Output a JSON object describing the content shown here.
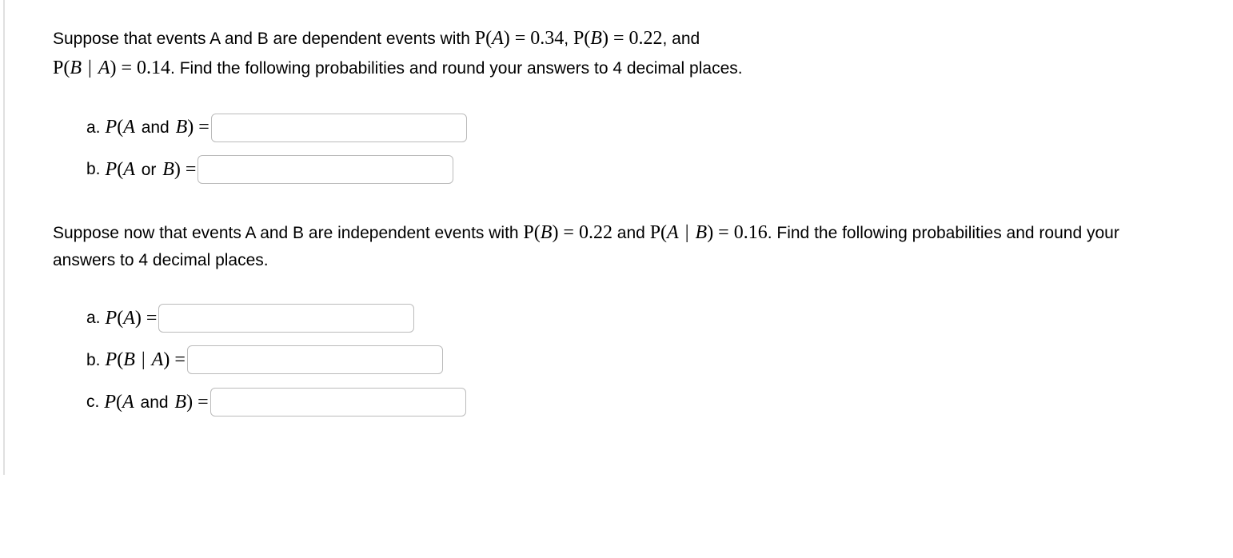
{
  "part1": {
    "intro_prefix": "Suppose that events A and B are dependent events with ",
    "pa_expr": "P(A) = 0.34",
    "sep1": ", ",
    "pb_expr": "P(B) = 0.22",
    "sep2": ", and ",
    "pba_expr": "P(B | A) = 0.14",
    "intro_suffix": ". Find the following probabilities and round your answers to 4 decimal places.",
    "items": [
      {
        "letter": "a.",
        "expr_left": "P(A",
        "word": " and ",
        "expr_right": "B) ="
      },
      {
        "letter": "b.",
        "expr_left": "P(A",
        "word": " or ",
        "expr_right": "B) ="
      }
    ]
  },
  "part2": {
    "intro_prefix": "Suppose now that events A and B are independent events with ",
    "pb_expr": "P(B) = 0.22",
    "sep1": " and ",
    "pab_expr": "P(A | B) = 0.16",
    "intro_suffix": ". Find the following probabilities and round your answers to 4 decimal places.",
    "items": [
      {
        "letter": "a.",
        "expr": "P(A) ="
      },
      {
        "letter": "b.",
        "expr": "P(B | A) ="
      },
      {
        "letter": "c.",
        "expr_left": "P(A",
        "word": " and ",
        "expr_right": "B) ="
      }
    ]
  }
}
